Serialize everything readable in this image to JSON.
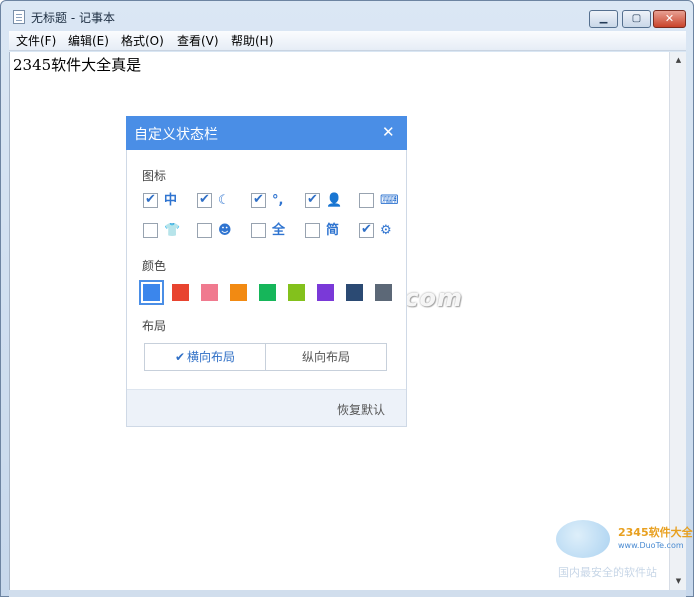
{
  "window": {
    "title": "无标题 - 记事本",
    "buttons": {
      "minimize": "▁",
      "maximize": "▢",
      "close": "✕"
    }
  },
  "menubar": [
    "文件(F)",
    "编辑(E)",
    "格式(O)",
    "查看(V)",
    "帮助(H)"
  ],
  "editor": {
    "text": "2345软件大全真是"
  },
  "dialog": {
    "title": "自定义状态栏",
    "close": "✕",
    "sections": {
      "icons": "图标",
      "colors": "颜色",
      "layout": "布局"
    },
    "icons": [
      {
        "name": "chinese-mode-icon",
        "glyph": "中",
        "checked": true
      },
      {
        "name": "moon-icon",
        "glyph": "☾",
        "checked": true
      },
      {
        "name": "punctuation-icon",
        "glyph": "°,",
        "checked": true
      },
      {
        "name": "user-icon",
        "glyph": "👤",
        "checked": true
      },
      {
        "name": "keyboard-icon",
        "glyph": "⌨",
        "checked": false
      },
      {
        "name": "skin-shirt-icon",
        "glyph": "👕",
        "checked": false
      },
      {
        "name": "emoji-icon",
        "glyph": "☻",
        "checked": false
      },
      {
        "name": "full-width-icon",
        "glyph": "全",
        "checked": false
      },
      {
        "name": "simplified-icon",
        "glyph": "简",
        "checked": false
      },
      {
        "name": "settings-gear-icon",
        "glyph": "⚙",
        "checked": true
      }
    ],
    "colors": [
      {
        "hex": "#3b86ec",
        "selected": true
      },
      {
        "hex": "#e8442f",
        "selected": false
      },
      {
        "hex": "#f07a8f",
        "selected": false
      },
      {
        "hex": "#f28a12",
        "selected": false
      },
      {
        "hex": "#16b65a",
        "selected": false
      },
      {
        "hex": "#83c11c",
        "selected": false
      },
      {
        "hex": "#7a39d8",
        "selected": false
      },
      {
        "hex": "#2b4a73",
        "selected": false
      },
      {
        "hex": "#5c6877",
        "selected": false
      }
    ],
    "layout": {
      "check": "✔",
      "horizontal": "横向布局",
      "vertical": "纵向布局",
      "selected": "horizontal"
    },
    "reset": "恢复默认"
  },
  "watermark": {
    "text": "www.DuoTe.com",
    "brand": "2345软件大全",
    "url": "www.DuoTe.com",
    "slogan": "国内最安全的软件站"
  }
}
